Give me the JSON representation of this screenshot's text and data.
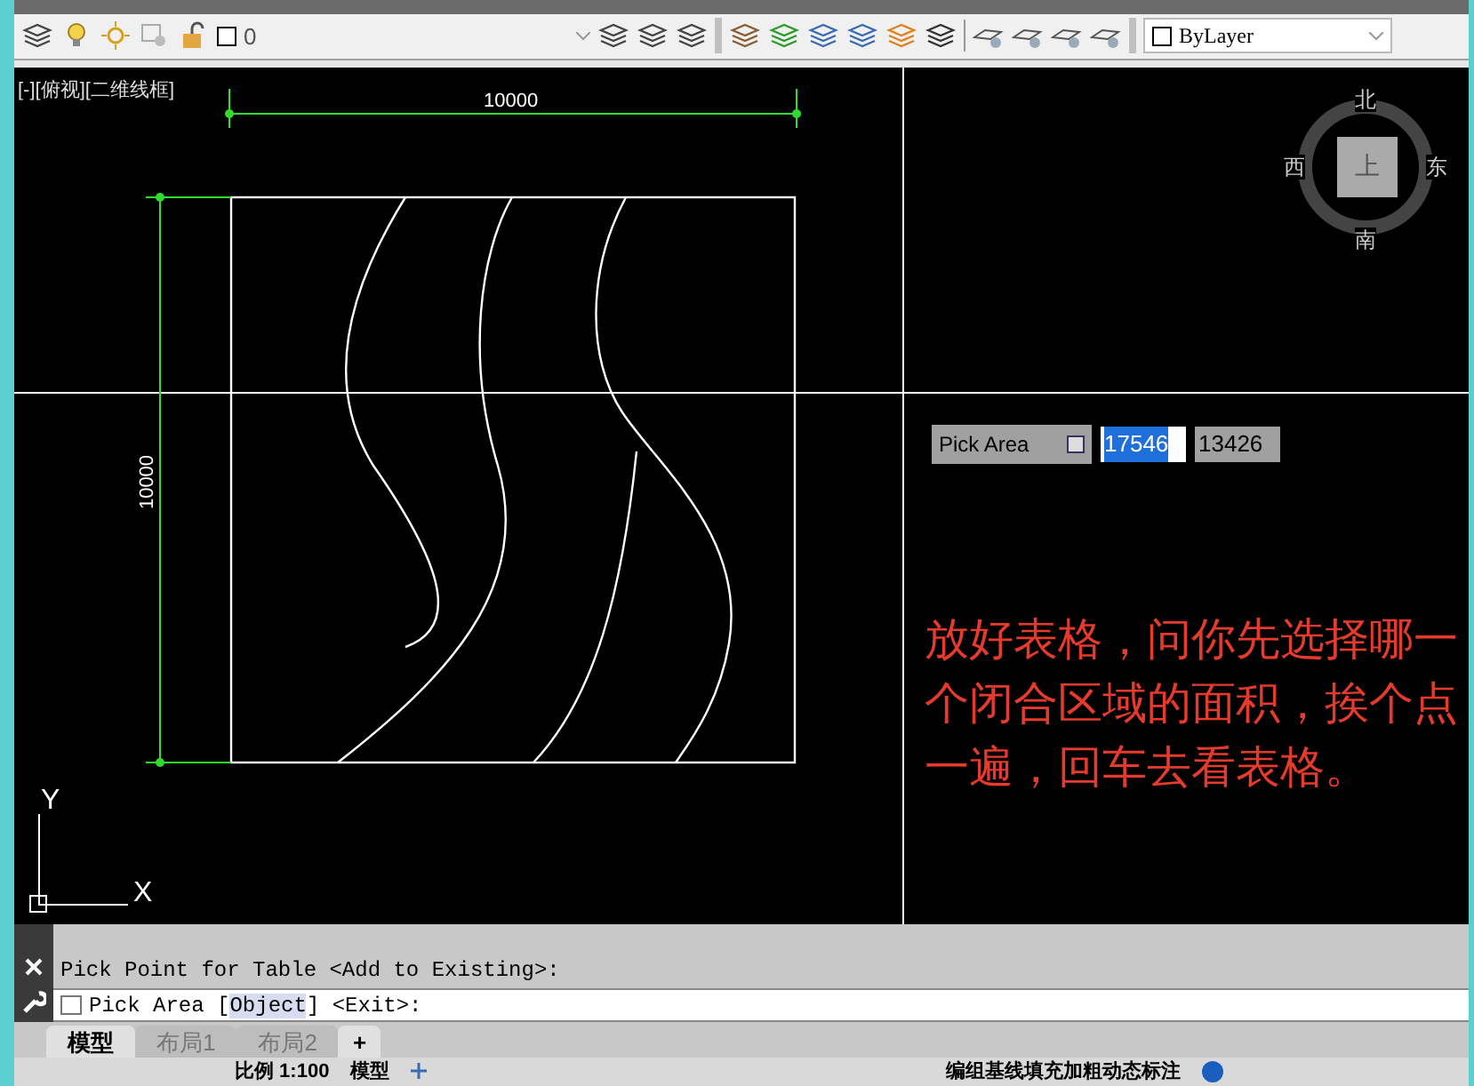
{
  "layer_toolbar": {
    "current_layer": "0",
    "color_control": "ByLayer"
  },
  "viewport": {
    "label": "[-][俯视][二维线框]",
    "dimensions": {
      "horizontal": "10000",
      "vertical": "10000"
    },
    "viewcube": {
      "north": "北",
      "west": "西",
      "east": "东",
      "south": "南",
      "face": "上"
    },
    "ucs": {
      "y": "Y",
      "x": "X"
    },
    "tooltip": {
      "label": "Pick Area",
      "fields": [
        {
          "value": "17546",
          "selected": true
        },
        {
          "value": "13426",
          "selected": false
        }
      ]
    },
    "annotation": "放好表格，问你先选择哪一个闭合区域的面积，挨个点一遍，回车去看表格。"
  },
  "command_line": {
    "history": "Pick Point for Table <Add to Existing>:",
    "prompt": {
      "before": "Pick Area [",
      "option": "Object",
      "after": "] <Exit>:"
    }
  },
  "layout_tabs": [
    {
      "label": "模型",
      "selected": true
    },
    {
      "label": "布局1",
      "selected": false
    },
    {
      "label": "布局2",
      "selected": false
    }
  ],
  "add_tab": "+",
  "status_bar": {
    "scale": "比例 1:100",
    "space": "模型",
    "annotation_text": "编组基线填充加粗动态标注"
  }
}
